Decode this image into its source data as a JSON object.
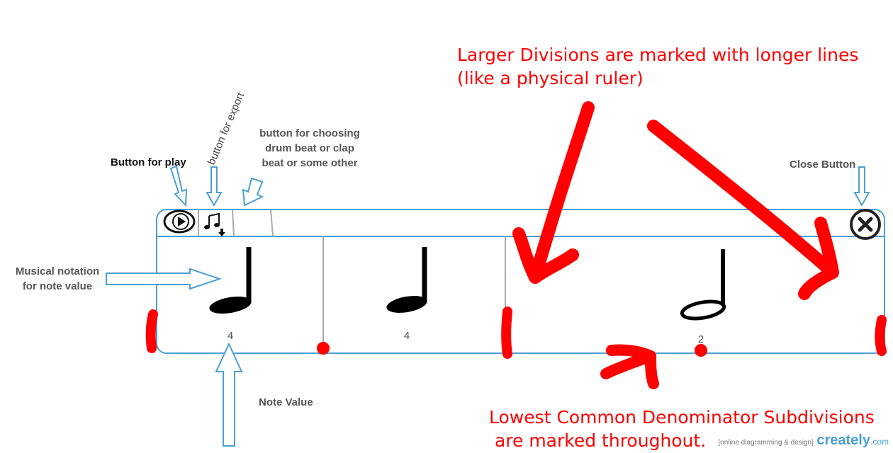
{
  "annotations": {
    "play": "Button for play",
    "export": "button for export",
    "beat_choice": "button for choosing\ndrum beat or clap\nbeat or some other",
    "close": "Close Button",
    "notation": "Musical notation\nfor note value",
    "note_value": "Note Value",
    "larger_divisions": "Larger Divisions are marked with longer lines\n(like a physical ruler)",
    "subdivisions": "Lowest Common Denominator Subdivisions\n are marked throughout."
  },
  "toolbar": {
    "play_icon": "play-icon",
    "export_icon": "music-note-download-icon",
    "close_icon": "close-x-icon"
  },
  "notes": [
    {
      "glyph": "quarter-note",
      "value": "4"
    },
    {
      "glyph": "quarter-note",
      "value": "4"
    },
    {
      "glyph": "half-note",
      "value": "2"
    }
  ],
  "watermark": {
    "tagline": "[online diagramming & design]",
    "brand": "creately",
    "suffix": ".com"
  },
  "colors": {
    "frame": "#4a9fd4",
    "arrow": "#4a9fd4",
    "ink_red": "#ff0000",
    "divider": "#aaaaaa"
  }
}
